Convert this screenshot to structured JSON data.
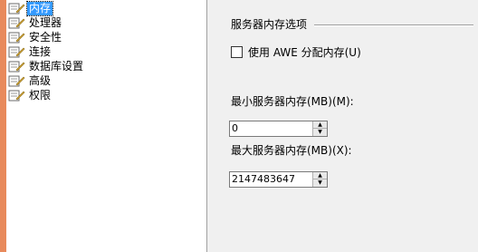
{
  "nav": {
    "items": [
      {
        "label": "内存",
        "icon": "page-icon",
        "selected": true
      },
      {
        "label": "处理器",
        "icon": "page-icon",
        "selected": false
      },
      {
        "label": "安全性",
        "icon": "page-icon",
        "selected": false
      },
      {
        "label": "连接",
        "icon": "page-icon",
        "selected": false
      },
      {
        "label": "数据库设置",
        "icon": "page-icon",
        "selected": false
      },
      {
        "label": "高级",
        "icon": "page-icon",
        "selected": false
      },
      {
        "label": "权限",
        "icon": "page-icon",
        "selected": false
      }
    ]
  },
  "memory": {
    "group_title": "服务器内存选项",
    "awe_label": "使用 AWE 分配内存(U)",
    "awe_checked": false,
    "min_label": "最小服务器内存(MB)(M):",
    "min_value": "0",
    "max_label": "最大服务器内存(MB)(X):",
    "max_value": "2147483647"
  },
  "colors": {
    "selection": "#3399ff",
    "left_strip": "#e88a5c",
    "panel_bg": "#f0f0f0"
  }
}
